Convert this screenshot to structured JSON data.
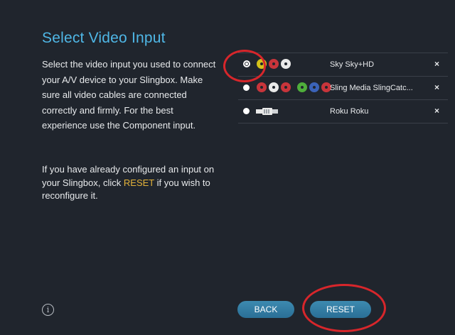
{
  "page": {
    "title": "Select Video Input",
    "description": "Select the video input you used to connect your A/V device to your Slingbox. Make sure all video cables are connected correctly and firmly. For the best experience use the Component input.",
    "reset_text_before": "If you have already configured an input on your Slingbox, click ",
    "reset_link": "RESET",
    "reset_text_after": " if you wish to reconfigure it."
  },
  "inputs": [
    {
      "name": "Sky Sky+HD",
      "selected": true,
      "icon": "composite-rca-plugs-icon",
      "remove": "×"
    },
    {
      "name": "Sling Media SlingCatc...",
      "selected": false,
      "icon": "component-rca-plugs-icon",
      "remove": "×"
    },
    {
      "name": "Roku Roku",
      "selected": false,
      "icon": "hdmi-plug-icon",
      "remove": "×"
    }
  ],
  "buttons": {
    "back": "BACK",
    "reset": "RESET"
  },
  "info_icon": "i",
  "colors": {
    "background": "#20252d",
    "title": "#4fb7e6",
    "link": "#e4b33a",
    "button": "#3d8ab0",
    "annotation": "#d7262b"
  }
}
